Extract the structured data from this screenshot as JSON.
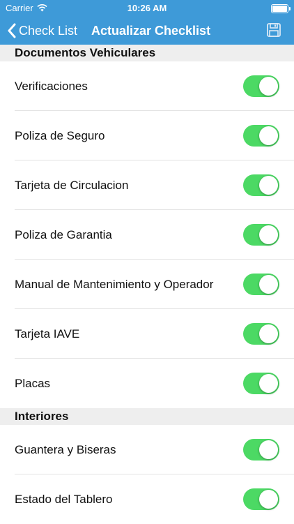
{
  "status_bar": {
    "carrier": "Carrier",
    "time": "10:26 AM"
  },
  "nav": {
    "back_label": "Check List",
    "title": "Actualizar Checklist"
  },
  "colors": {
    "accent": "#3e9ad8",
    "toggle_on": "#4cd964",
    "section_bg": "#eeeeee"
  },
  "icons": {
    "back": "chevron-left-icon",
    "save": "floppy-disk-icon",
    "wifi": "wifi-icon",
    "battery": "battery-icon"
  },
  "sections": [
    {
      "title": "Documentos Vehiculares",
      "items": [
        {
          "label": "Verificaciones",
          "on": true
        },
        {
          "label": "Poliza de Seguro",
          "on": true
        },
        {
          "label": "Tarjeta de Circulacion",
          "on": true
        },
        {
          "label": "Poliza de Garantia",
          "on": true
        },
        {
          "label": "Manual de Mantenimiento y Operador",
          "on": true
        },
        {
          "label": "Tarjeta IAVE",
          "on": true
        },
        {
          "label": "Placas",
          "on": true
        }
      ]
    },
    {
      "title": "Interiores",
      "items": [
        {
          "label": "Guantera y Biseras",
          "on": true
        },
        {
          "label": "Estado del Tablero",
          "on": true
        }
      ]
    }
  ]
}
